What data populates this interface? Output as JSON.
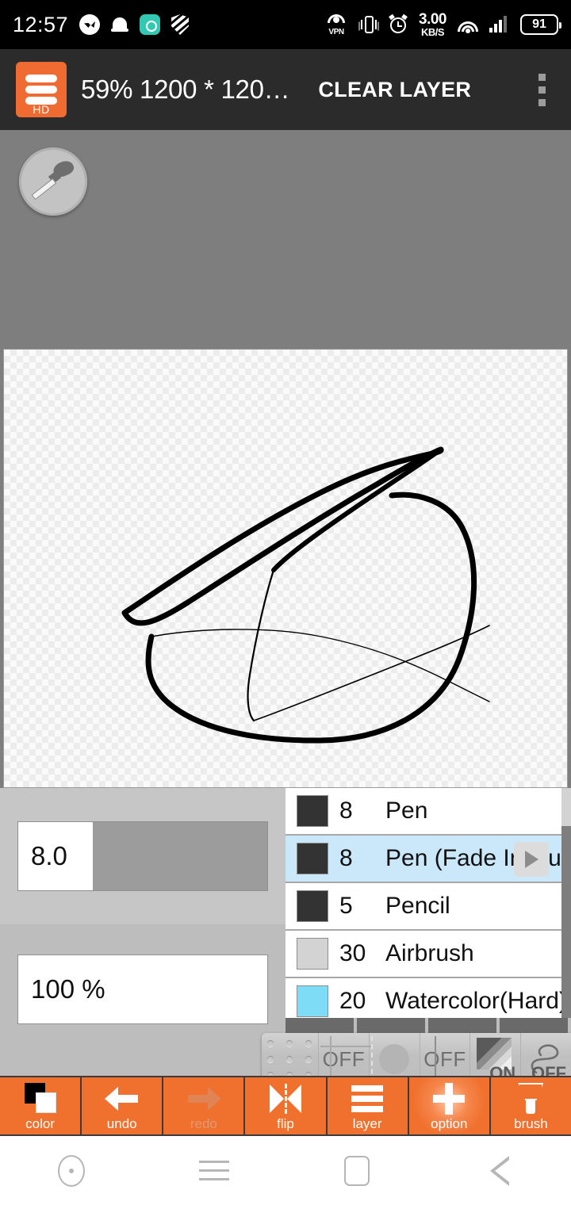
{
  "status_bar": {
    "clock": "12:57",
    "left_icons": [
      "messenger-icon",
      "bell-icon",
      "green-app-icon",
      "shield-icon"
    ],
    "vpn_label": "VPN",
    "network_speed_value": "3.00",
    "network_speed_unit": "KB/S",
    "right_icons": [
      "vpn-icon",
      "vibrate-icon",
      "alarm-icon",
      "wifi-icon",
      "signal-icon"
    ],
    "battery": "91"
  },
  "app_bar": {
    "logo_label": "HD",
    "title": "59% 1200 * 120…",
    "action": "CLEAR LAYER",
    "menu_icon": "overflow-menu-icon"
  },
  "workspace": {
    "picker_tool": "eyedropper-icon",
    "canvas_background": "transparent-checkerboard"
  },
  "sliders": {
    "size": {
      "label": "brush-size",
      "value": "8.0",
      "fill_percent": 30
    },
    "opacity": {
      "label": "opacity",
      "value": "100 %",
      "fill_percent": 100
    }
  },
  "brush_list": {
    "rows": [
      {
        "swatch": "#333333",
        "size": "8",
        "name": "Pen",
        "selected": false
      },
      {
        "swatch": "#333333",
        "size": "8",
        "name": "Pen (Fade In/Out",
        "selected": true
      },
      {
        "swatch": "#333333",
        "size": "5",
        "name": "Pencil",
        "selected": false
      },
      {
        "swatch": "#d3d3d3",
        "size": "30",
        "name": "Airbrush",
        "selected": false
      },
      {
        "swatch": "#7fdcf7",
        "size": "20",
        "name": "Watercolor(Hard)",
        "selected": false
      }
    ],
    "expand_icon": "play-triangle-icon",
    "scrollbar": "brush-list-scrollbar"
  },
  "float_bar": {
    "handle_icon": "drag-handle-dots-icon",
    "items": [
      {
        "icon": "crosshair-icon",
        "state": "OFF"
      },
      {
        "icon": "circle-icon",
        "state": ""
      },
      {
        "icon": "vertical-line-icon",
        "state": "OFF"
      },
      {
        "icon": "gradient-square-icon",
        "state": "ON"
      },
      {
        "icon": "squiggle-icon",
        "state": "OFF"
      }
    ]
  },
  "toolbar": {
    "buttons": [
      {
        "label": "color",
        "icon": "color-swatch-icon",
        "disabled": false,
        "glow": false
      },
      {
        "label": "undo",
        "icon": "arrow-left-icon",
        "disabled": false,
        "glow": false
      },
      {
        "label": "redo",
        "icon": "arrow-right-icon",
        "disabled": true,
        "glow": false
      },
      {
        "label": "flip",
        "icon": "flip-horizontal-icon",
        "disabled": false,
        "glow": false
      },
      {
        "label": "layer",
        "icon": "layers-icon",
        "disabled": false,
        "glow": false
      },
      {
        "label": "option",
        "icon": "plus-icon",
        "disabled": false,
        "glow": true
      },
      {
        "label": "brush",
        "icon": "brush-icon",
        "disabled": false,
        "glow": false
      }
    ],
    "accent_color": "#f0702e"
  },
  "nav_bar": {
    "buttons": [
      "assistant-dot-icon",
      "recents-menu-icon",
      "home-square-icon",
      "back-triangle-icon"
    ]
  }
}
